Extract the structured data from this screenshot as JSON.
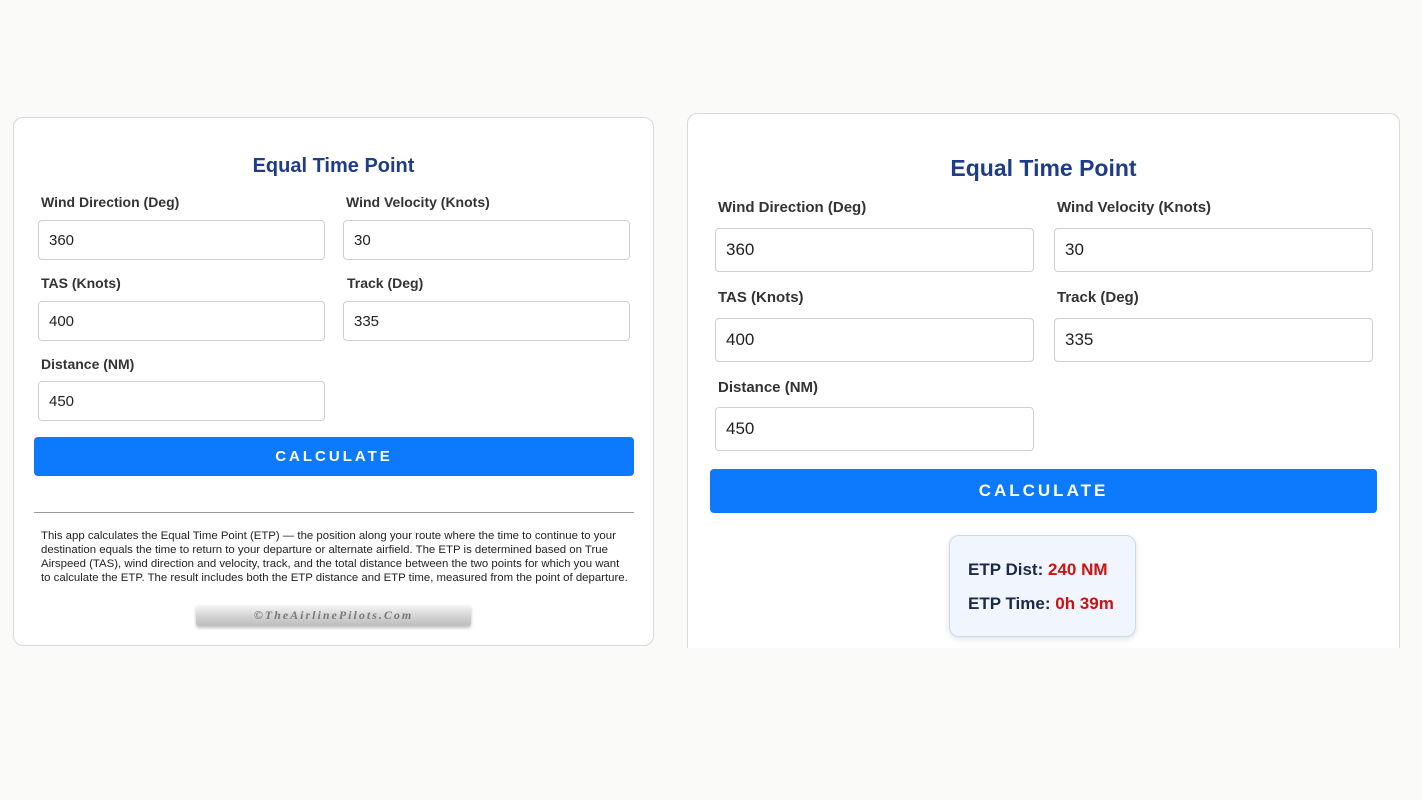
{
  "left_panel": {
    "title": "Equal Time Point",
    "fields": {
      "wind_direction": {
        "label": "Wind Direction (Deg)",
        "value": "360"
      },
      "wind_velocity": {
        "label": "Wind Velocity (Knots)",
        "value": "30"
      },
      "tas": {
        "label": "TAS (Knots)",
        "value": "400"
      },
      "track": {
        "label": "Track (Deg)",
        "value": "335"
      },
      "distance": {
        "label": "Distance (NM)",
        "value": "450"
      }
    },
    "calculate_label": "CALCULATE",
    "description": "This app calculates the Equal Time Point (ETP) — the position along your route where the time to continue to your destination equals the time to return to your departure or alternate airfield. The ETP is determined based on True Airspeed (TAS), wind direction and velocity, track, and the total distance between the two points for which you want to calculate the ETP. The result includes both the ETP distance and ETP time, measured from the point of departure.",
    "logo_text": "©TheAirlinePilots.Com"
  },
  "right_panel": {
    "title": "Equal Time Point",
    "fields": {
      "wind_direction": {
        "label": "Wind Direction (Deg)",
        "value": "360"
      },
      "wind_velocity": {
        "label": "Wind Velocity (Knots)",
        "value": "30"
      },
      "tas": {
        "label": "TAS (Knots)",
        "value": "400"
      },
      "track": {
        "label": "Track (Deg)",
        "value": "335"
      },
      "distance": {
        "label": "Distance (NM)",
        "value": "450"
      }
    },
    "calculate_label": "CALCULATE",
    "result": {
      "etp_dist_label": "ETP Dist:",
      "etp_dist_value": "240 NM",
      "etp_time_label": "ETP Time:",
      "etp_time_value": "0h 39m"
    }
  },
  "colors": {
    "title": "#1f3c88",
    "button": "#0d79fc",
    "result_value": "#cc1111",
    "result_bg": "#f1f6fe"
  }
}
